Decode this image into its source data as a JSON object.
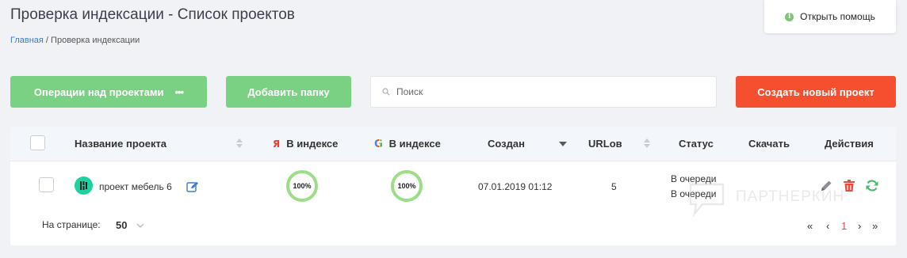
{
  "page": {
    "title": "Проверка индексации - Список проектов"
  },
  "breadcrumb": {
    "home": "Главная",
    "separator": " / ",
    "current": "Проверка индексации"
  },
  "help": {
    "label": "Открыть помощь",
    "icon": "info-icon"
  },
  "toolbar": {
    "operations_label": "Операции над проектами",
    "operations_dots": "•••",
    "add_folder_label": "Добавить папку",
    "search_placeholder": "Поиск",
    "search_value": "",
    "create_label": "Создать новый проект"
  },
  "table": {
    "headers": {
      "name": "Название проекта",
      "yandex_index": "В индексе",
      "yandex_icon_glyph": "Я",
      "google_index": "В индексе",
      "google_icon_glyph": "G",
      "created": "Создан",
      "urls": "URLов",
      "status": "Статус",
      "download": "Скачать",
      "actions": "Действия"
    },
    "rows": [
      {
        "name": "проект мебель 6",
        "yandex_index": "100%",
        "google_index": "100%",
        "created": "07.01.2019 01:12",
        "urls": "5",
        "status": [
          "В очереди",
          "В очереди"
        ],
        "download": ""
      }
    ]
  },
  "pagination": {
    "per_page_label": "На странице:",
    "per_page_value": "50",
    "first": "«",
    "prev": "‹",
    "current": "1",
    "next": "›",
    "last": "»"
  },
  "watermark": {
    "text": "ПАРТНЕРКИН"
  },
  "colors": {
    "green_button": "#7ad184",
    "create_button": "#f4502f",
    "ring": "#9bde86",
    "project_icon": "#1fd1a0",
    "link": "#3a7bd5",
    "delete": "#e74c3c",
    "refresh": "#4cbb6c"
  }
}
